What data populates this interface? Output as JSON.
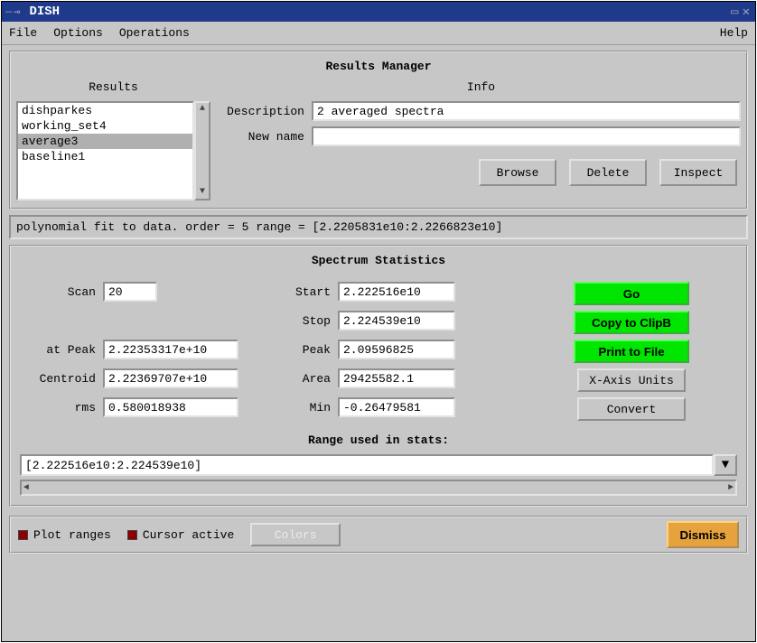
{
  "window": {
    "title": "DISH"
  },
  "menubar": {
    "file": "File",
    "options": "Options",
    "operations": "Operations",
    "help": "Help"
  },
  "results_manager": {
    "title": "Results Manager",
    "results_label": "Results",
    "info_label": "Info",
    "items": [
      "dishparkes",
      "working_set4",
      "average3",
      "baseline1"
    ],
    "selected_index": 2,
    "description_label": "Description",
    "description_value": "2 averaged spectra",
    "newname_label": "New name",
    "newname_value": "",
    "buttons": {
      "browse": "Browse",
      "delete": "Delete",
      "inspect": "Inspect"
    }
  },
  "status": "polynomial fit to data. order = 5 range = [2.2205831e10:2.2266823e10]",
  "spectrum": {
    "title": "Spectrum Statistics",
    "left": {
      "scan_label": "Scan",
      "scan": "20",
      "at_peak_label": "at Peak",
      "at_peak": "2.22353317e+10",
      "centroid_label": "Centroid",
      "centroid": "2.22369707e+10",
      "rms_label": "rms",
      "rms": "0.580018938"
    },
    "mid": {
      "start_label": "Start",
      "start": "2.222516e10",
      "stop_label": "Stop",
      "stop": "2.224539e10",
      "peak_label": "Peak",
      "peak": "2.09596825",
      "area_label": "Area",
      "area": "29425582.1",
      "min_label": "Min",
      "min": "-0.26479581"
    },
    "buttons": {
      "go": "Go",
      "copy": "Copy to ClipB",
      "print": "Print to File",
      "xaxis": "X-Axis Units",
      "convert": "Convert"
    },
    "range_title": "Range used in stats:",
    "range_value": "[2.222516e10:2.224539e10]"
  },
  "bottom": {
    "plot_ranges": "Plot ranges",
    "cursor_active": "Cursor active",
    "colors": "Colors",
    "dismiss": "Dismiss"
  }
}
